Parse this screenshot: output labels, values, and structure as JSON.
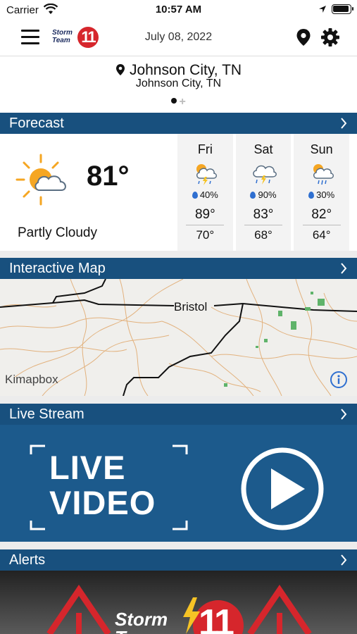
{
  "status_bar": {
    "carrier": "Carrier",
    "time": "10:57 AM"
  },
  "header": {
    "logo_text_line1": "Storm",
    "logo_text_line2": "Team",
    "logo_number": "11",
    "date": "July 08, 2022"
  },
  "location": {
    "city": "Johnson City, TN",
    "subtitle": "Johnson City, TN"
  },
  "sections": {
    "forecast": "Forecast",
    "map": "Interactive Map",
    "live": "Live Stream",
    "alerts": "Alerts"
  },
  "current": {
    "temp": "81°",
    "condition": "Partly Cloudy"
  },
  "days": [
    {
      "name": "Fri",
      "rain": "40%",
      "hi": "89°",
      "lo": "70°"
    },
    {
      "name": "Sat",
      "rain": "90%",
      "hi": "83°",
      "lo": "68°"
    },
    {
      "name": "Sun",
      "rain": "30%",
      "hi": "82°",
      "lo": "64°"
    }
  ],
  "map": {
    "label": "Bristol",
    "attribution": "Kimapbox"
  },
  "live": {
    "line1": "LIVE",
    "line2": "VIDEO"
  },
  "alerts_banner": {
    "line1": "Storm",
    "line2": "Team",
    "number": "11"
  }
}
